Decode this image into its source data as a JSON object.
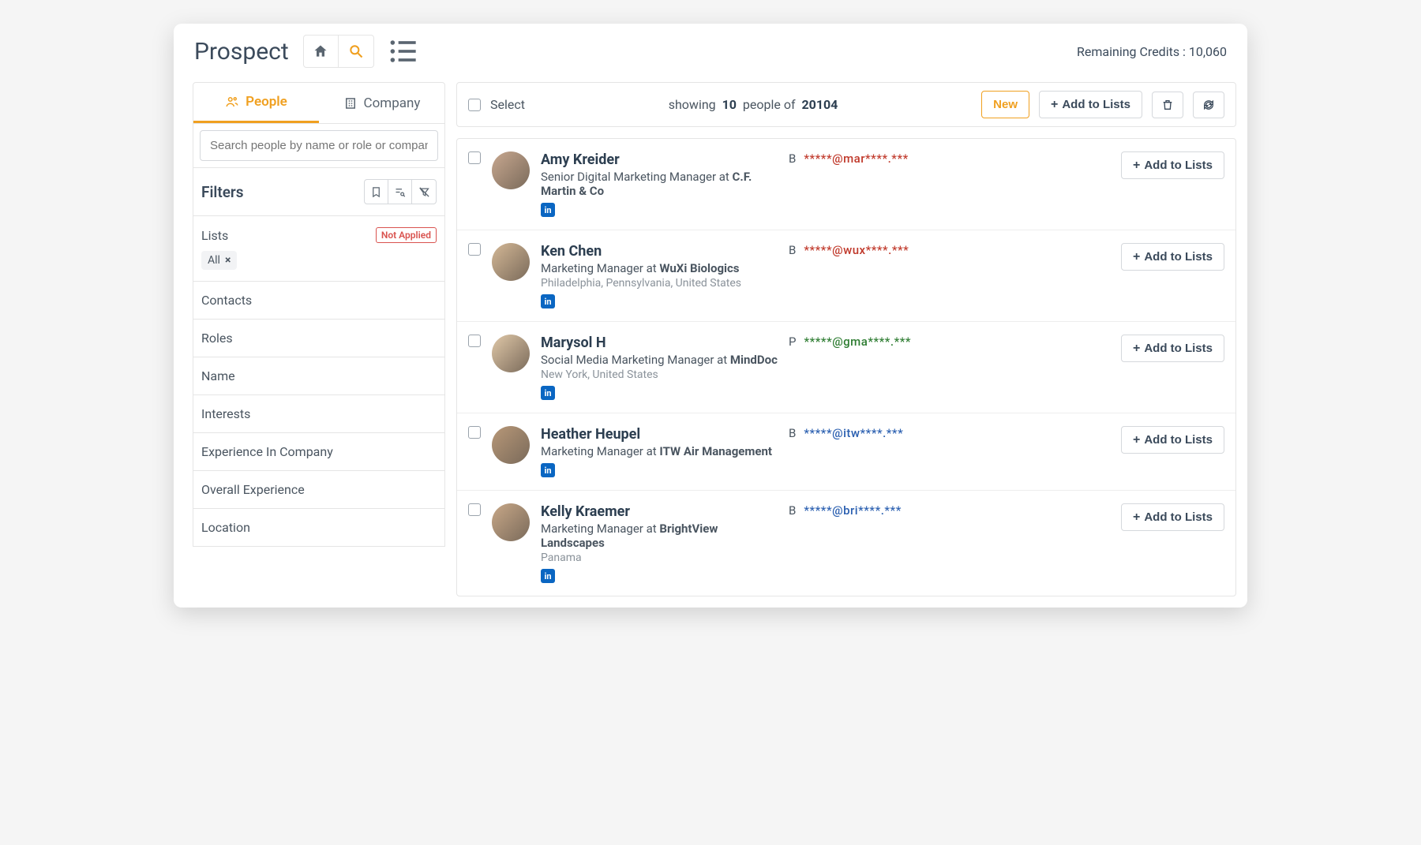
{
  "header": {
    "title": "Prospect",
    "credits_label": "Remaining Credits :",
    "credits_value": "10,060"
  },
  "sidebar": {
    "tabs": {
      "people": "People",
      "company": "Company"
    },
    "search_placeholder": "Search people by name or role or company",
    "filters_title": "Filters",
    "lists": {
      "label": "Lists",
      "badge": "Not Applied",
      "chip": "All"
    },
    "sections": [
      "Contacts",
      "Roles",
      "Name",
      "Interests",
      "Experience In Company",
      "Overall Experience",
      "Location"
    ]
  },
  "toolbar": {
    "select": "Select",
    "showing_prefix": "showing",
    "showing_count": "10",
    "showing_mid": "people of",
    "showing_total": "20104",
    "new": "New",
    "add_to_lists": "Add to Lists"
  },
  "row_add_label": "Add to Lists",
  "results": [
    {
      "name": "Amy Kreider",
      "title_prefix": "Senior Digital Marketing Manager at ",
      "company": "C.F. Martin & Co",
      "location": "",
      "email_type": "B",
      "email_mask": "*****@mar****.***",
      "email_class": "red"
    },
    {
      "name": "Ken Chen",
      "title_prefix": "Marketing Manager at ",
      "company": "WuXi Biologics",
      "location": "Philadelphia, Pennsylvania, United States",
      "email_type": "B",
      "email_mask": "*****@wux****.***",
      "email_class": "red"
    },
    {
      "name": "Marysol H",
      "title_prefix": "Social Media Marketing Manager at ",
      "company": "MindDoc",
      "location": "New York, United States",
      "email_type": "P",
      "email_mask": "*****@gma****.***",
      "email_class": "green"
    },
    {
      "name": "Heather Heupel",
      "title_prefix": "Marketing Manager at ",
      "company": "ITW Air Management",
      "location": "",
      "email_type": "B",
      "email_mask": "*****@itw****.***",
      "email_class": "blue"
    },
    {
      "name": "Kelly Kraemer",
      "title_prefix": "Marketing Manager at ",
      "company": "BrightView Landscapes",
      "location": "Panama",
      "email_type": "B",
      "email_mask": "*****@bri****.***",
      "email_class": "blue"
    }
  ]
}
